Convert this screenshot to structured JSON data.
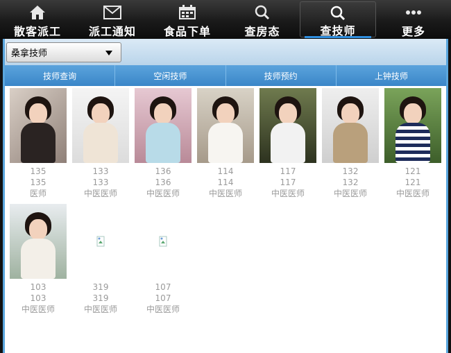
{
  "nav": {
    "items": [
      {
        "label": "散客派工",
        "icon": "home-icon"
      },
      {
        "label": "派工通知",
        "icon": "mail-icon"
      },
      {
        "label": "食品下单",
        "icon": "calendar-icon"
      },
      {
        "label": "查房态",
        "icon": "search-icon"
      },
      {
        "label": "查技师",
        "icon": "search-icon",
        "active": true
      },
      {
        "label": "更多",
        "icon": "more-icon"
      }
    ],
    "active_color": "#2f8fe0"
  },
  "filter": {
    "selected": "桑拿技师"
  },
  "tabs": [
    "技师查询",
    "空闲技师",
    "技师预约",
    "上钟技师"
  ],
  "technicians": [
    {
      "id": "135",
      "code": "135",
      "title": "医师",
      "photo": true
    },
    {
      "id": "133",
      "code": "133",
      "title": "中医医师",
      "photo": true
    },
    {
      "id": "136",
      "code": "136",
      "title": "中医医师",
      "photo": true
    },
    {
      "id": "114",
      "code": "114",
      "title": "中医医师",
      "photo": true
    },
    {
      "id": "117",
      "code": "117",
      "title": "中医医师",
      "photo": true
    },
    {
      "id": "132",
      "code": "132",
      "title": "中医医师",
      "photo": true
    },
    {
      "id": "121",
      "code": "121",
      "title": "中医医师",
      "photo": true
    },
    {
      "id": "103",
      "code": "103",
      "title": "中医医师",
      "photo": true
    },
    {
      "id": "319",
      "code": "319",
      "title": "中医医师",
      "photo": false
    },
    {
      "id": "107",
      "code": "107",
      "title": "中医医师",
      "photo": false
    }
  ]
}
